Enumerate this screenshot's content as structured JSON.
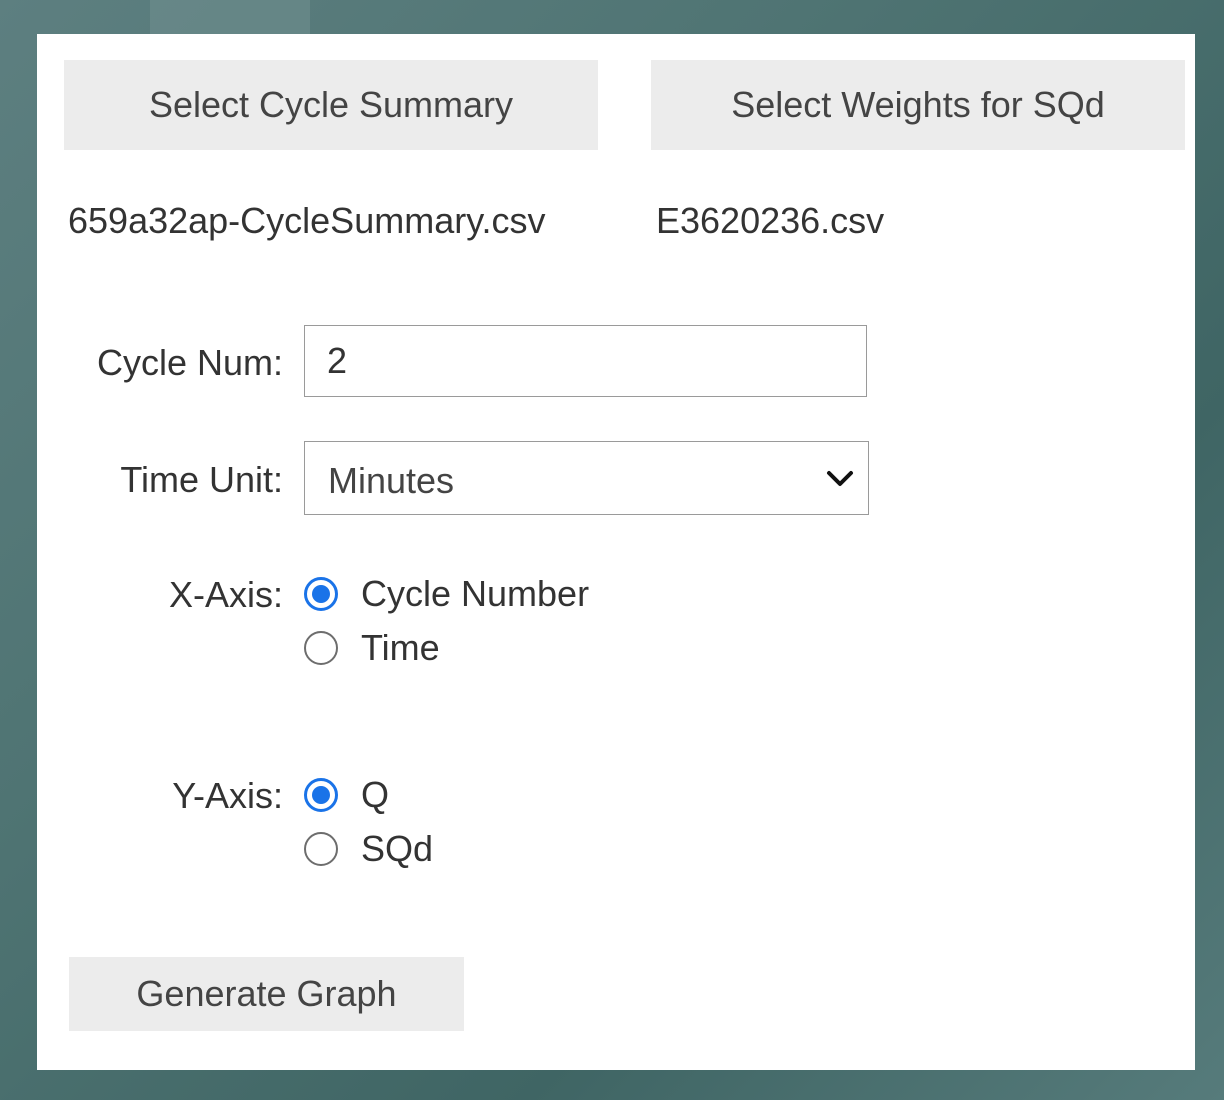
{
  "buttons": {
    "select_cycle_summary": "Select Cycle Summary",
    "select_weights": "Select Weights for SQd",
    "generate_graph": "Generate Graph"
  },
  "files": {
    "cycle_summary": "659a32ap-CycleSummary.csv",
    "weights": "E3620236.csv"
  },
  "fields": {
    "cycle_num_label": "Cycle Num:",
    "cycle_num_value": "2",
    "time_unit_label": "Time Unit:",
    "time_unit_selected": "Minutes"
  },
  "x_axis": {
    "label": "X-Axis:",
    "options": [
      "Cycle Number",
      "Time"
    ],
    "selected": "Cycle Number"
  },
  "y_axis": {
    "label": "Y-Axis:",
    "options": [
      "Q",
      "SQd"
    ],
    "selected": "Q"
  },
  "colors": {
    "radio_accent": "#1a73e8",
    "button_bg": "#ececec",
    "panel_bg": "#ffffff"
  },
  "icons": {
    "select_arrow": "chevron-down-icon"
  }
}
